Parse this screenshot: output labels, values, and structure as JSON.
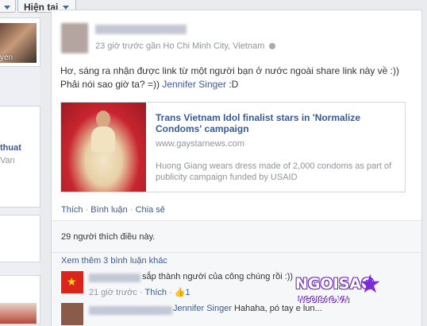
{
  "top_buttons": {
    "partial_label": "g",
    "current_label": "Hiện tại"
  },
  "left": {
    "name_fragment": "yen",
    "item_title": "thuat",
    "item_sub": "Van"
  },
  "post": {
    "meta": "23 giờ trước gần Ho Chi Minh City, Vietnam",
    "text_before": "Hơ, sáng ra nhận được link từ một người bạn ở nước ngoài share link này về :)) Phải nói sao giờ ta? =)) ",
    "mention": "Jennifer Singer",
    "text_after": " :D",
    "share": {
      "title": "Trans Vietnam Idol finalist stars in 'Normalize Condoms' campaign",
      "domain": "www.gaystarnews.com",
      "desc": "Huong Giang wears dress made of 2,000 condoms as part of publicity campaign funded by USAID"
    },
    "actions": {
      "like": "Thích",
      "sep1": " · ",
      "comment": "Bình luận",
      "sep2": " · ",
      "share": "Chia sẻ"
    },
    "likes": "29 người thích điều này.",
    "more_comments": "Xem thêm 3 bình luận khác",
    "comment1": {
      "text": "sắp thành người của công chúng rồi :))",
      "time": "21 giờ trước",
      "like": "Thích",
      "count": "1"
    },
    "comment2": {
      "mention": "Jennifer Singer",
      "text": " Hahaha, pó tay e lun",
      "cut": "..."
    }
  },
  "watermark": {
    "brand": "NGOISAO",
    "site": "NGOISAO.VN"
  },
  "colors": {
    "link": "#3b5998",
    "bg": "#e9ebee",
    "brand": "#7b2bd8"
  }
}
